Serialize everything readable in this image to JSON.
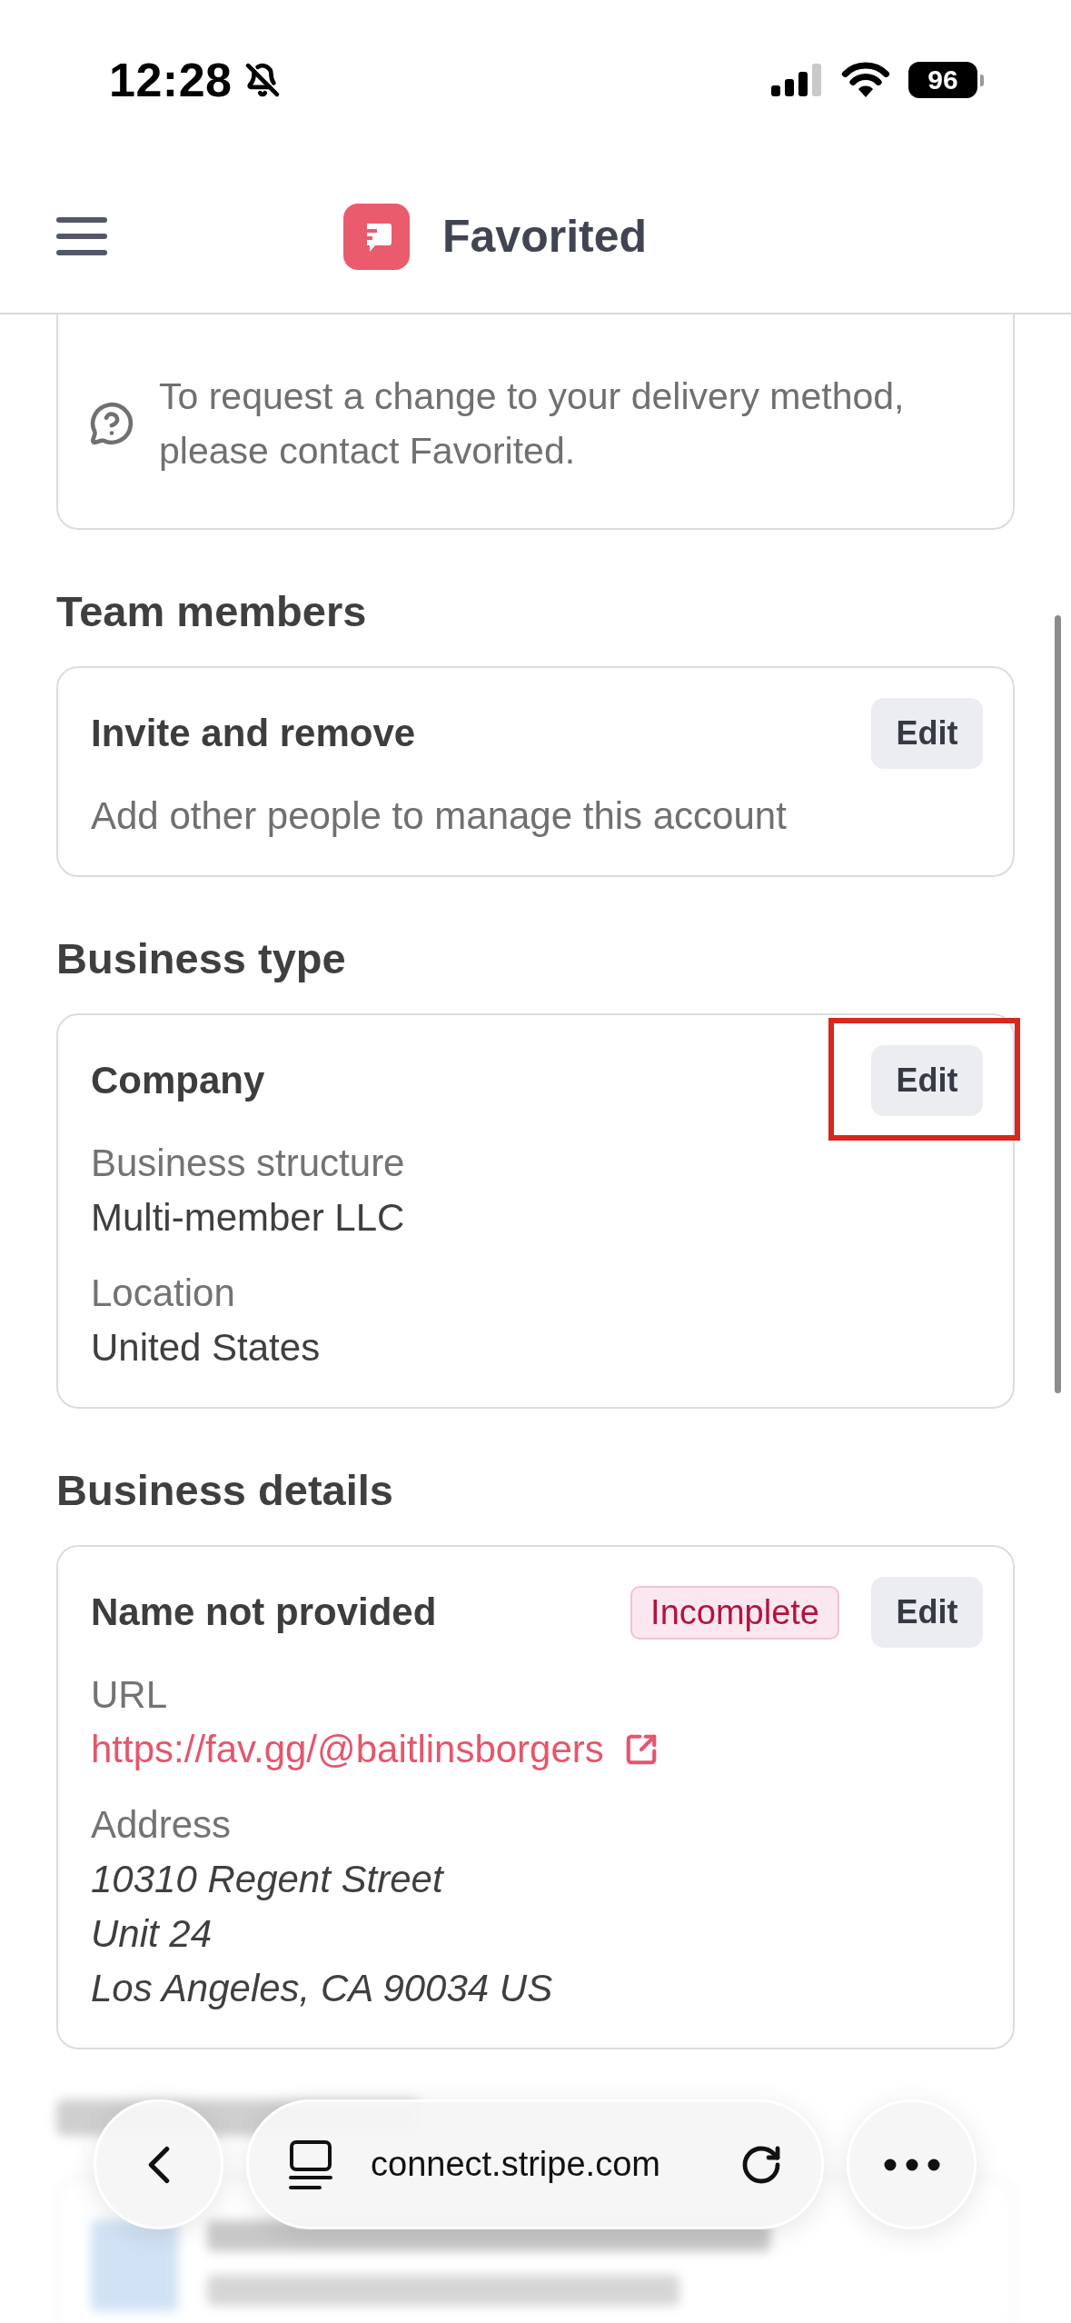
{
  "status_bar": {
    "time": "12:28",
    "silent": true,
    "battery": "96"
  },
  "header": {
    "title": "Favorited"
  },
  "delivery_notice": {
    "text": "To request a change to your delivery method, please contact Favorited."
  },
  "sections": [
    {
      "kind": "action",
      "heading": "Team members",
      "title": "Invite and remove",
      "description": "Add other people to manage this account",
      "edit_button": {
        "label": "Edit",
        "highlighted": false
      }
    },
    {
      "kind": "fields",
      "heading": "Business type",
      "title": "Company",
      "edit_button": {
        "label": "Edit",
        "highlighted": true
      },
      "fields": [
        {
          "kind": "text",
          "label": "Business structure",
          "lines": [
            "Multi-member LLC"
          ]
        },
        {
          "kind": "text",
          "label": "Location",
          "lines": [
            "United States"
          ]
        }
      ]
    },
    {
      "kind": "fields",
      "heading": "Business details",
      "title": "Name not provided",
      "badge": "Incomplete",
      "edit_button": {
        "label": "Edit",
        "highlighted": false
      },
      "fields": [
        {
          "kind": "link",
          "label": "URL",
          "lines": [
            "https://fav.gg/@baitlinsborgers"
          ]
        },
        {
          "kind": "address",
          "label": "Address",
          "lines": [
            "10310 Regent Street",
            "Unit 24",
            "Los Angeles, CA 90034 US"
          ]
        }
      ]
    }
  ],
  "browser_bar": {
    "url": "connect.stripe.com"
  }
}
